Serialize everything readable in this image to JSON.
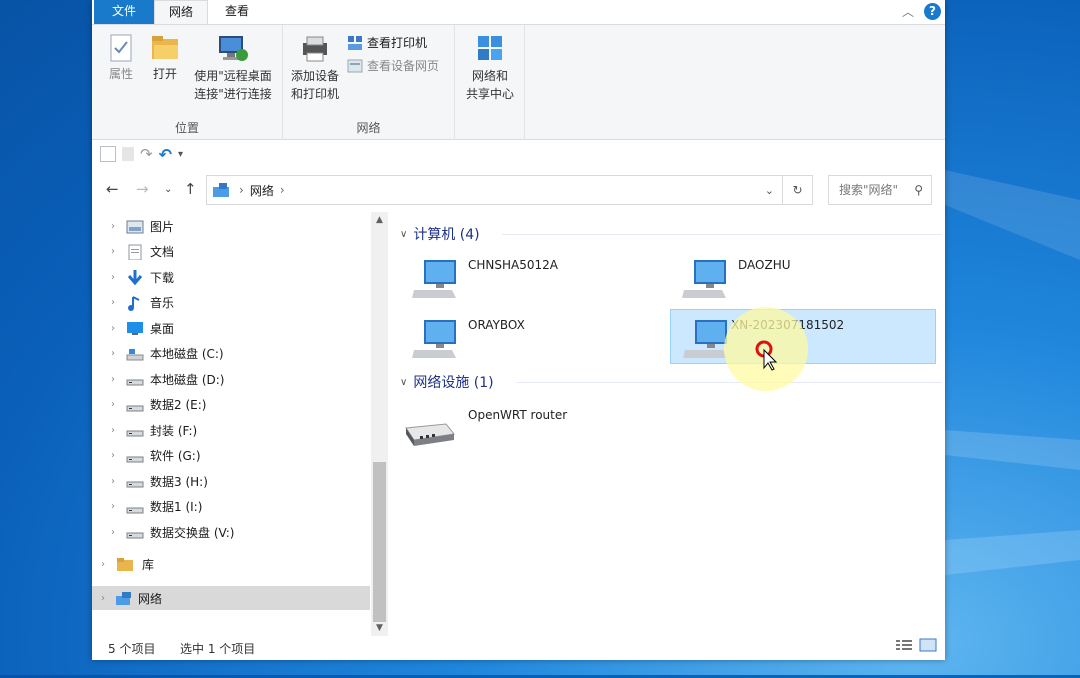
{
  "ribbon": {
    "tabs": {
      "file": "文件",
      "network": "网络",
      "view": "查看"
    },
    "groups": {
      "location": {
        "label": "位置",
        "properties": "属性",
        "open": "打开",
        "remote_line1": "使用\"远程桌面",
        "remote_line2": "连接\"进行连接"
      },
      "network": {
        "label": "网络",
        "add_line1": "添加设备",
        "add_line2": "和打印机",
        "view_printers": "查看打印机",
        "view_device_page": "查看设备网页",
        "sharing_line1": "网络和",
        "sharing_line2": "共享中心"
      }
    }
  },
  "address": {
    "path": "网络",
    "search_placeholder": "搜索\"网络\""
  },
  "navpane": {
    "items": [
      {
        "label": "图片",
        "icon": "pictures-icon"
      },
      {
        "label": "文档",
        "icon": "documents-icon"
      },
      {
        "label": "下载",
        "icon": "downloads-icon"
      },
      {
        "label": "音乐",
        "icon": "music-icon"
      },
      {
        "label": "桌面",
        "icon": "desktop-icon"
      },
      {
        "label": "本地磁盘 (C:)",
        "icon": "system-drive-icon"
      },
      {
        "label": "本地磁盘 (D:)",
        "icon": "drive-icon"
      },
      {
        "label": "数据2 (E:)",
        "icon": "drive-icon"
      },
      {
        "label": "封装 (F:)",
        "icon": "drive-icon"
      },
      {
        "label": "软件 (G:)",
        "icon": "drive-icon"
      },
      {
        "label": "数据3 (H:)",
        "icon": "drive-icon"
      },
      {
        "label": "数据1 (I:)",
        "icon": "drive-icon"
      },
      {
        "label": "数据交换盘 (V:)",
        "icon": "drive-icon"
      }
    ],
    "library": "库",
    "network": "网络"
  },
  "content": {
    "computers_header": "计算机 (4)",
    "computers": [
      "CHNSHA5012A",
      "DAOZHU",
      "ORAYBOX",
      "XN-202307181502"
    ],
    "devices_header": "网络设施 (1)",
    "devices": [
      "OpenWRT router"
    ]
  },
  "status": {
    "count": "5 个项目",
    "selected": "选中 1 个项目"
  },
  "colors": {
    "accent": "#1979ca",
    "selection": "#cce8ff",
    "group_header": "#1e3287"
  }
}
